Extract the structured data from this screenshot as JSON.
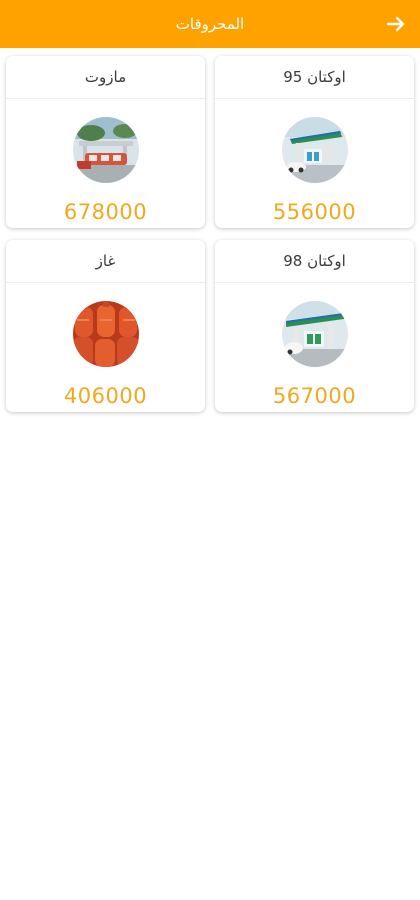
{
  "appbar": {
    "title": "المحروقات",
    "back_icon": "arrow-right-icon",
    "color": "#FFA200"
  },
  "products": [
    {
      "name": "اوكتان 95",
      "price": "556000",
      "image": "gas-station-photo"
    },
    {
      "name": "مازوت",
      "price": "678000",
      "image": "fuel-truck-photo"
    },
    {
      "name": "اوكتان 98",
      "price": "567000",
      "image": "gas-station-photo"
    },
    {
      "name": "غاز",
      "price": "406000",
      "image": "gas-cylinders-photo"
    }
  ],
  "colors": {
    "price": "#F2A81D",
    "title_text": "#3a3a3a"
  }
}
